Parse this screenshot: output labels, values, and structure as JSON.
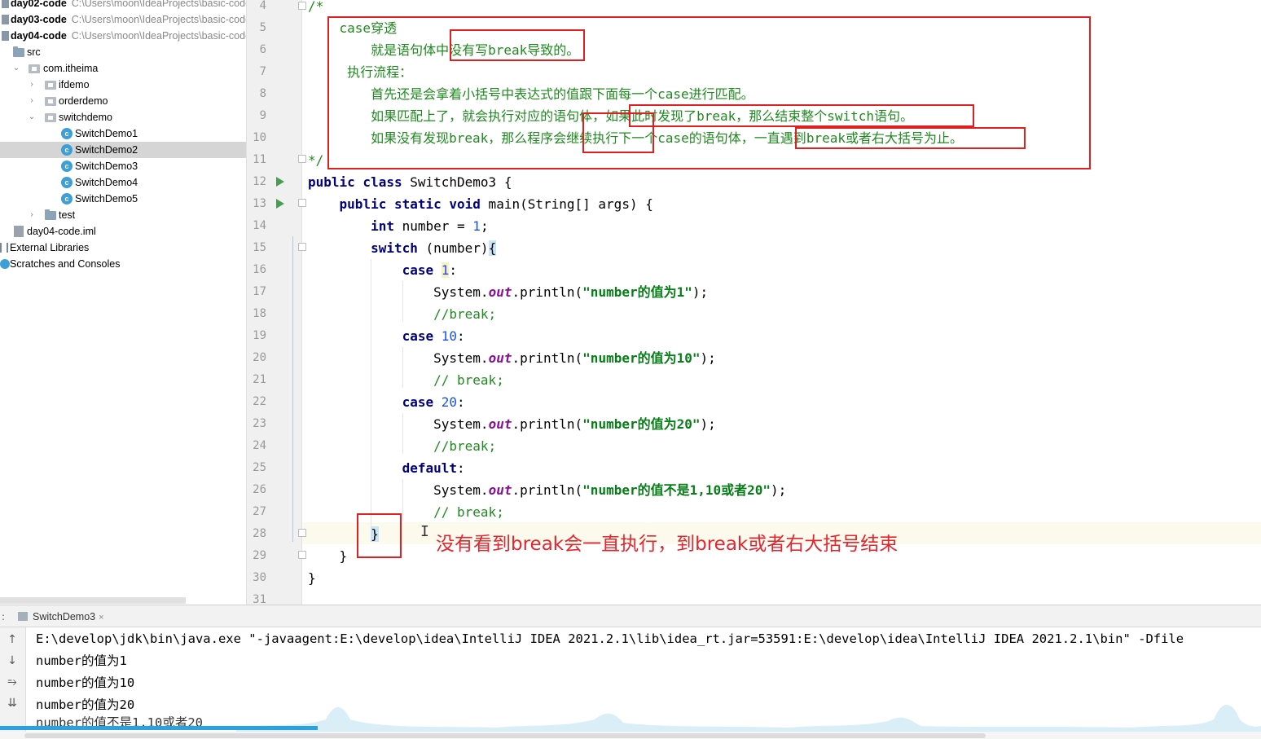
{
  "project_tree": [
    {
      "label": "day02-code",
      "path": "C:\\Users\\moon\\IdeaProjects\\basic-code",
      "bold": true,
      "icon": "module-icon"
    },
    {
      "label": "day03-code",
      "path": "C:\\Users\\moon\\IdeaProjects\\basic-code",
      "bold": true,
      "icon": "module-icon"
    },
    {
      "label": "day04-code",
      "path": "C:\\Users\\moon\\IdeaProjects\\basic-code",
      "bold": true,
      "icon": "module-icon"
    },
    {
      "label": "src",
      "icon": "folder-icon"
    },
    {
      "label": "com.itheima",
      "icon": "package-icon",
      "arrow": "expanded"
    },
    {
      "label": "ifdemo",
      "icon": "package-icon",
      "arrow": "collapsed"
    },
    {
      "label": "orderdemo",
      "icon": "package-icon",
      "arrow": "collapsed"
    },
    {
      "label": "switchdemo",
      "icon": "package-icon",
      "arrow": "expanded"
    },
    {
      "label": "SwitchDemo1",
      "icon": "class-icon"
    },
    {
      "label": "SwitchDemo2",
      "icon": "class-icon",
      "selected": true
    },
    {
      "label": "SwitchDemo3",
      "icon": "class-icon"
    },
    {
      "label": "SwitchDemo4",
      "icon": "class-icon"
    },
    {
      "label": "SwitchDemo5",
      "icon": "class-icon"
    },
    {
      "label": "test",
      "icon": "folder-icon",
      "arrow": "collapsed"
    },
    {
      "label": "day04-code.iml",
      "icon": "iml-icon"
    },
    {
      "label": "External Libraries",
      "icon": "library-icon"
    },
    {
      "label": "Scratches and Consoles",
      "icon": "scratch-icon"
    }
  ],
  "editor": {
    "line_numbers": [
      "4",
      "5",
      "6",
      "7",
      "8",
      "9",
      "10",
      "11",
      "12",
      "13",
      "14",
      "15",
      "16",
      "17",
      "18",
      "19",
      "20",
      "21",
      "22",
      "23",
      "24",
      "25",
      "26",
      "27",
      "28",
      "29",
      "30",
      "31"
    ],
    "comment": {
      "open": "/*",
      "line5_a": "case",
      "line5_b": "穿透",
      "line6_a": "就是语句体中没有写",
      "line6_b": "break",
      "line6_c": "导致的。",
      "line7": "执行流程：",
      "line8_a": "首先还是会拿着小括号中表达式的值跟下面每一个",
      "line8_b": "case",
      "line8_c": "进行匹配。",
      "line9_a": "如果匹配上了，就会执行对应的语句体，如果此时发现了",
      "line9_b": "break",
      "line9_c": "，那么结束整个",
      "line9_d": "switch",
      "line9_e": "语句。",
      "line10_a": "如果没有发现",
      "line10_b": "break",
      "line10_c": "，那么程序会继续执行下一个",
      "line10_d": "case",
      "line10_e": "的语句体，一直遇到",
      "line10_f": "break",
      "line10_g": "或者右大括号为止。",
      "close": "*/"
    },
    "code": {
      "l12_kw": "public class",
      "l12_rest": " SwitchDemo3 {",
      "l13_kw": "public static void",
      "l13_rest": " main(String[] args) {",
      "l14_kw": "int",
      "l14_a": " number = ",
      "l14_num": "1",
      "l14_b": ";",
      "l15_kw": "switch",
      "l15_rest": " (number)",
      "l15_brace": "{",
      "case_kw": "case",
      "l16_num": "1",
      "colon": ":",
      "sys": "System.",
      "out": "out",
      "println": ".println(",
      "end": ");",
      "l17_str": "\"number的值为1\"",
      "l18_cmt": "//break;",
      "l19_num": "10",
      "l20_str": "\"number的值为10\"",
      "l21_cmt": "// break;",
      "l22_num": "20",
      "l23_str": "\"number的值为20\"",
      "l24_cmt": "//break;",
      "default_kw": "default",
      "l26_str": "\"number的值不是1,10或者20\"",
      "l27_cmt": "// break;",
      "close_brace": "}"
    },
    "annotation": "没有看到break会一直执行，到break或者右大括号结束"
  },
  "run_panel": {
    "tab_label": "SwitchDemo3",
    "tab_close": "×",
    "output": [
      "E:\\develop\\jdk\\bin\\java.exe \"-javaagent:E:\\develop\\idea\\IntelliJ IDEA 2021.2.1\\lib\\idea_rt.jar=53591:E:\\develop\\idea\\IntelliJ IDEA 2021.2.1\\bin\" -Dfile",
      "number的值为1",
      "number的值为10",
      "number的值为20",
      "number的值不是1,10或者20"
    ]
  },
  "colors": {
    "keyword": "#00007f",
    "comment": "#1f8a1f",
    "string": "#067d17",
    "number": "#1750eb",
    "annotation_red": "#e3262e"
  }
}
